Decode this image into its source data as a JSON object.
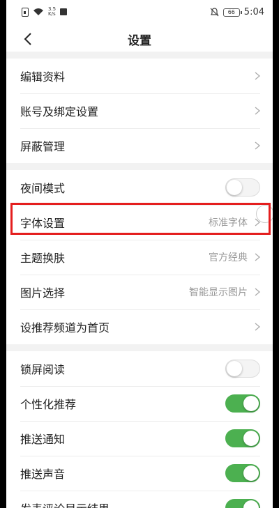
{
  "status_bar": {
    "speed_top": "3.5",
    "speed_bottom": "K/s",
    "battery": "66",
    "time": "5:04"
  },
  "header": {
    "title": "设置"
  },
  "sections": [
    {
      "rows": [
        {
          "label": "编辑资料",
          "type": "chevron"
        },
        {
          "label": "账号及绑定设置",
          "type": "chevron"
        },
        {
          "label": "屏蔽管理",
          "type": "chevron"
        }
      ]
    },
    {
      "rows": [
        {
          "label": "夜间模式",
          "type": "toggle",
          "on": false
        },
        {
          "label": "字体设置",
          "type": "value",
          "value": "标准字体"
        },
        {
          "label": "主题换肤",
          "type": "value",
          "value": "官方经典"
        },
        {
          "label": "图片选择",
          "type": "value",
          "value": "智能显示图片"
        },
        {
          "label": "设推荐频道为首页",
          "type": "chevron"
        }
      ]
    },
    {
      "rows": [
        {
          "label": "锁屏阅读",
          "type": "toggle",
          "on": false
        },
        {
          "label": "个性化推荐",
          "type": "toggle",
          "on": true
        },
        {
          "label": "推送通知",
          "type": "toggle",
          "on": true
        },
        {
          "label": "推送声音",
          "type": "toggle",
          "on": true
        },
        {
          "label": "发表评论显示结果",
          "type": "toggle",
          "on": true
        }
      ]
    }
  ],
  "colors": {
    "toggle_on": "#4cb050",
    "highlight": "#e41e1e"
  }
}
